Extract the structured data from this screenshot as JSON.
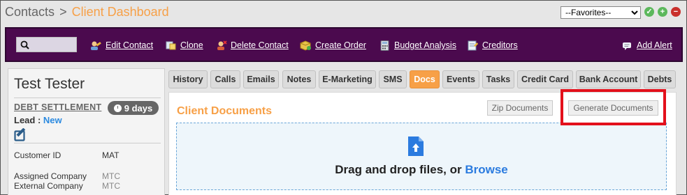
{
  "header": {
    "crumb_root": "Contacts",
    "crumb_sep": ">",
    "crumb_current": "Client Dashboard"
  },
  "favorites": {
    "selected": "--Favorites--",
    "icons": [
      "ok-circle-icon",
      "add-circle-icon",
      "remove-circle-icon"
    ]
  },
  "toolbar": {
    "search_placeholder": "",
    "items": [
      {
        "label": "Edit Contact",
        "icon": "edit-contact-icon"
      },
      {
        "label": "Clone",
        "icon": "clone-icon"
      },
      {
        "label": "Delete Contact",
        "icon": "delete-contact-icon"
      },
      {
        "label": "Create Order",
        "icon": "create-order-icon"
      },
      {
        "label": "Budget Analysis",
        "icon": "calculator-icon"
      },
      {
        "label": "Creditors",
        "icon": "creditors-icon"
      },
      {
        "label": "Add Alert",
        "icon": "chat-icon"
      }
    ]
  },
  "contact": {
    "name": "Test Tester",
    "program": "DEBT SETTLEMENT",
    "days": "9 days",
    "lead_label": "Lead :",
    "lead_value": "New",
    "fields": [
      {
        "label": "Customer ID",
        "value": "MAT"
      },
      {
        "label": "Assigned Company",
        "value": "MTC"
      },
      {
        "label": "External Company",
        "value": "MTC"
      }
    ]
  },
  "tabs": [
    {
      "label": "History"
    },
    {
      "label": "Calls"
    },
    {
      "label": "Emails"
    },
    {
      "label": "Notes"
    },
    {
      "label": "E-Marketing"
    },
    {
      "label": "SMS"
    },
    {
      "label": "Docs",
      "active": true
    },
    {
      "label": "Events"
    },
    {
      "label": "Tasks"
    },
    {
      "label": "Credit Card"
    },
    {
      "label": "Bank Account"
    },
    {
      "label": "Debts"
    }
  ],
  "documents": {
    "title": "Client Documents",
    "zip_label": "Zip Documents",
    "generate_label": "Generate Documents",
    "drop_text": "Drag and drop files, or",
    "browse_label": "Browse"
  },
  "colors": {
    "toolbar_bg": "#4b0a4e",
    "accent_orange": "#f7a047",
    "link_blue": "#2b7bdf",
    "highlight_red": "#e3101b"
  }
}
